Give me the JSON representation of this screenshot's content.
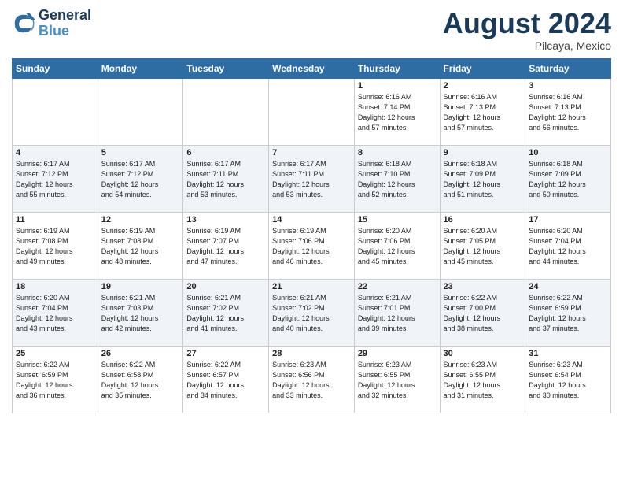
{
  "header": {
    "logo_line1": "General",
    "logo_line2": "Blue",
    "month_year": "August 2024",
    "location": "Pilcaya, Mexico"
  },
  "days_of_week": [
    "Sunday",
    "Monday",
    "Tuesday",
    "Wednesday",
    "Thursday",
    "Friday",
    "Saturday"
  ],
  "weeks": [
    [
      {
        "day": "",
        "info": ""
      },
      {
        "day": "",
        "info": ""
      },
      {
        "day": "",
        "info": ""
      },
      {
        "day": "",
        "info": ""
      },
      {
        "day": "1",
        "info": "Sunrise: 6:16 AM\nSunset: 7:14 PM\nDaylight: 12 hours\nand 57 minutes."
      },
      {
        "day": "2",
        "info": "Sunrise: 6:16 AM\nSunset: 7:13 PM\nDaylight: 12 hours\nand 57 minutes."
      },
      {
        "day": "3",
        "info": "Sunrise: 6:16 AM\nSunset: 7:13 PM\nDaylight: 12 hours\nand 56 minutes."
      }
    ],
    [
      {
        "day": "4",
        "info": "Sunrise: 6:17 AM\nSunset: 7:12 PM\nDaylight: 12 hours\nand 55 minutes."
      },
      {
        "day": "5",
        "info": "Sunrise: 6:17 AM\nSunset: 7:12 PM\nDaylight: 12 hours\nand 54 minutes."
      },
      {
        "day": "6",
        "info": "Sunrise: 6:17 AM\nSunset: 7:11 PM\nDaylight: 12 hours\nand 53 minutes."
      },
      {
        "day": "7",
        "info": "Sunrise: 6:17 AM\nSunset: 7:11 PM\nDaylight: 12 hours\nand 53 minutes."
      },
      {
        "day": "8",
        "info": "Sunrise: 6:18 AM\nSunset: 7:10 PM\nDaylight: 12 hours\nand 52 minutes."
      },
      {
        "day": "9",
        "info": "Sunrise: 6:18 AM\nSunset: 7:09 PM\nDaylight: 12 hours\nand 51 minutes."
      },
      {
        "day": "10",
        "info": "Sunrise: 6:18 AM\nSunset: 7:09 PM\nDaylight: 12 hours\nand 50 minutes."
      }
    ],
    [
      {
        "day": "11",
        "info": "Sunrise: 6:19 AM\nSunset: 7:08 PM\nDaylight: 12 hours\nand 49 minutes."
      },
      {
        "day": "12",
        "info": "Sunrise: 6:19 AM\nSunset: 7:08 PM\nDaylight: 12 hours\nand 48 minutes."
      },
      {
        "day": "13",
        "info": "Sunrise: 6:19 AM\nSunset: 7:07 PM\nDaylight: 12 hours\nand 47 minutes."
      },
      {
        "day": "14",
        "info": "Sunrise: 6:19 AM\nSunset: 7:06 PM\nDaylight: 12 hours\nand 46 minutes."
      },
      {
        "day": "15",
        "info": "Sunrise: 6:20 AM\nSunset: 7:06 PM\nDaylight: 12 hours\nand 45 minutes."
      },
      {
        "day": "16",
        "info": "Sunrise: 6:20 AM\nSunset: 7:05 PM\nDaylight: 12 hours\nand 45 minutes."
      },
      {
        "day": "17",
        "info": "Sunrise: 6:20 AM\nSunset: 7:04 PM\nDaylight: 12 hours\nand 44 minutes."
      }
    ],
    [
      {
        "day": "18",
        "info": "Sunrise: 6:20 AM\nSunset: 7:04 PM\nDaylight: 12 hours\nand 43 minutes."
      },
      {
        "day": "19",
        "info": "Sunrise: 6:21 AM\nSunset: 7:03 PM\nDaylight: 12 hours\nand 42 minutes."
      },
      {
        "day": "20",
        "info": "Sunrise: 6:21 AM\nSunset: 7:02 PM\nDaylight: 12 hours\nand 41 minutes."
      },
      {
        "day": "21",
        "info": "Sunrise: 6:21 AM\nSunset: 7:02 PM\nDaylight: 12 hours\nand 40 minutes."
      },
      {
        "day": "22",
        "info": "Sunrise: 6:21 AM\nSunset: 7:01 PM\nDaylight: 12 hours\nand 39 minutes."
      },
      {
        "day": "23",
        "info": "Sunrise: 6:22 AM\nSunset: 7:00 PM\nDaylight: 12 hours\nand 38 minutes."
      },
      {
        "day": "24",
        "info": "Sunrise: 6:22 AM\nSunset: 6:59 PM\nDaylight: 12 hours\nand 37 minutes."
      }
    ],
    [
      {
        "day": "25",
        "info": "Sunrise: 6:22 AM\nSunset: 6:59 PM\nDaylight: 12 hours\nand 36 minutes."
      },
      {
        "day": "26",
        "info": "Sunrise: 6:22 AM\nSunset: 6:58 PM\nDaylight: 12 hours\nand 35 minutes."
      },
      {
        "day": "27",
        "info": "Sunrise: 6:22 AM\nSunset: 6:57 PM\nDaylight: 12 hours\nand 34 minutes."
      },
      {
        "day": "28",
        "info": "Sunrise: 6:23 AM\nSunset: 6:56 PM\nDaylight: 12 hours\nand 33 minutes."
      },
      {
        "day": "29",
        "info": "Sunrise: 6:23 AM\nSunset: 6:55 PM\nDaylight: 12 hours\nand 32 minutes."
      },
      {
        "day": "30",
        "info": "Sunrise: 6:23 AM\nSunset: 6:55 PM\nDaylight: 12 hours\nand 31 minutes."
      },
      {
        "day": "31",
        "info": "Sunrise: 6:23 AM\nSunset: 6:54 PM\nDaylight: 12 hours\nand 30 minutes."
      }
    ]
  ]
}
